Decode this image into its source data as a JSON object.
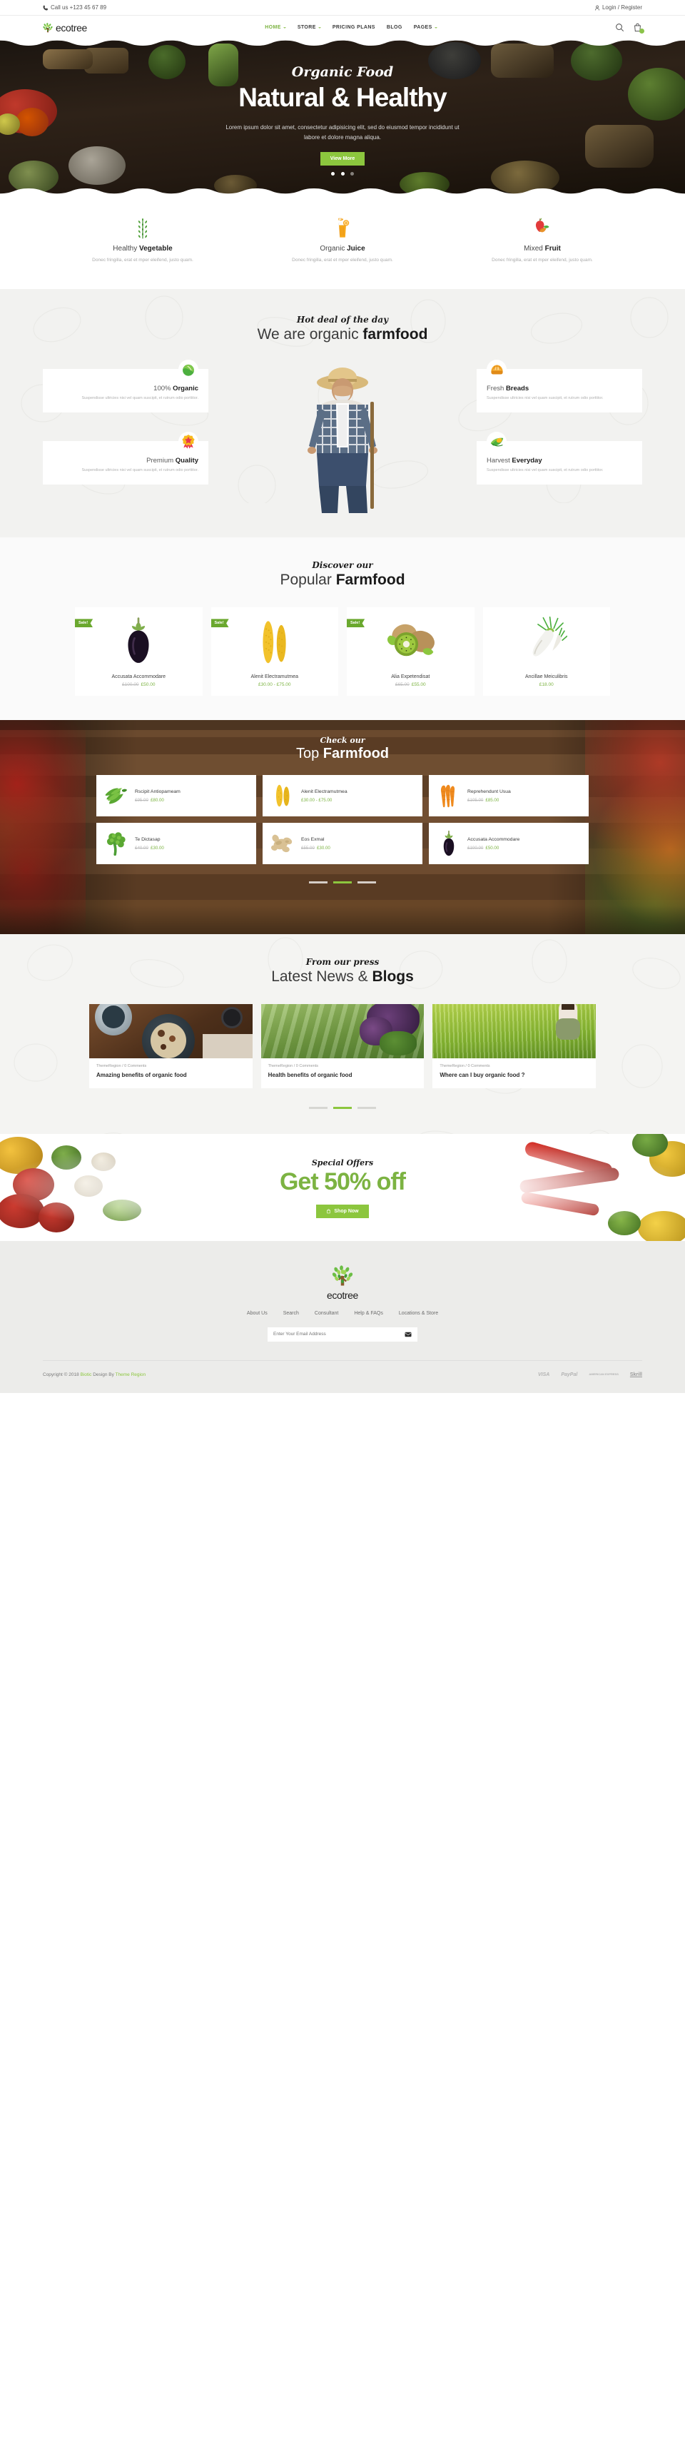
{
  "topbar": {
    "phone": "Call us +123 45 67 89",
    "account": "Login / Register"
  },
  "header": {
    "brand": "ecotree",
    "nav": [
      {
        "label": "HOME",
        "caret": true,
        "active": true
      },
      {
        "label": "STORE",
        "caret": true,
        "active": false
      },
      {
        "label": "PRICING PLANS",
        "caret": false,
        "active": false
      },
      {
        "label": "BLOG",
        "caret": false,
        "active": false
      },
      {
        "label": "PAGES",
        "caret": true,
        "active": false
      }
    ],
    "search_icon": "search-icon",
    "cart_icon": "cart-icon",
    "cart_count": ""
  },
  "hero": {
    "script": "Organic Food",
    "title": "Natural & Healthy",
    "desc": "Lorem ipsum dolor sit amet, consectetur adipisicing elit, sed do eiusmod tempor incididunt ut labore et dolore magna aliqua.",
    "button": "View More",
    "slides": 3,
    "active_slide": 1
  },
  "features": [
    {
      "icon": "wheat-icon",
      "title_light": "Healthy ",
      "title_bold": "Vegetable",
      "desc": "Donec fringilla, erat et mper eleifend, justo quam."
    },
    {
      "icon": "juice-icon",
      "title_light": "Organic ",
      "title_bold": "Juice",
      "desc": "Donec fringilla, erat et mper eleifend, justo quam."
    },
    {
      "icon": "fruit-icon",
      "title_light": "Mixed ",
      "title_bold": "Fruit",
      "desc": "Donec fringilla, erat et mper eleifend, justo quam."
    }
  ],
  "hotdeal": {
    "script": "Hot deal of the day",
    "title_light": "We are organic ",
    "title_bold": "farmfood",
    "left": [
      {
        "icon": "cabbage-icon",
        "title_light": "100% ",
        "title_bold": "Organic",
        "desc": "Suspendisse ultricies nisi vel quam suscipit, et rutrum odio porttitor."
      },
      {
        "icon": "medal-icon",
        "title_light": "Premium ",
        "title_bold": "Quality",
        "desc": "Suspendisse ultricies nisi vel quam suscipit, et rutrum odio porttitor."
      }
    ],
    "right": [
      {
        "icon": "bread-icon",
        "title_light": "Fresh ",
        "title_bold": "Breads",
        "desc": "Suspendisse ultricies nisi vel quam suscipit, et rutrum odio porttitor."
      },
      {
        "icon": "harvest-icon",
        "title_light": "Harvest ",
        "title_bold": "Everyday",
        "desc": "Suspendisse ultricies nisi vel quam suscipit, et rutrum odio porttitor."
      }
    ]
  },
  "popular": {
    "script": "Discover our",
    "title_light": "Popular ",
    "title_bold": "Farmfood",
    "products": [
      {
        "sale": "Sale!",
        "name": "Accusata Accommodare",
        "old": "£100.00",
        "price": "£50.00",
        "img": "eggplant-image"
      },
      {
        "sale": "Sale!",
        "name": "Alenit Electramutmea",
        "old": "",
        "price": "£30.00 - £75.00",
        "img": "corn-image"
      },
      {
        "sale": "Sale!",
        "name": "Alia Expetendisat",
        "old": "£65.00",
        "price": "£55.00",
        "img": "kiwi-image"
      },
      {
        "sale": "",
        "name": "Ancillae Meiculibris",
        "old": "",
        "price": "£18.00",
        "img": "radish-image"
      }
    ]
  },
  "topfarm": {
    "script": "Check our",
    "title_light": "Top ",
    "title_bold": "Farmfood",
    "items": [
      {
        "name": "Rscipit Antiopameam",
        "old": "£95.00",
        "price": "£80.00",
        "img": "beans-image"
      },
      {
        "name": "Alenit Electramutmea",
        "old": "",
        "price": "£30.00 - £75.00",
        "img": "corn-image"
      },
      {
        "name": "Reprehendunt Usua",
        "old": "£105.00",
        "price": "£85.00",
        "img": "carrot-image"
      },
      {
        "name": "Te Dictasap",
        "old": "£40.00",
        "price": "£30.00",
        "img": "broccoli-image"
      },
      {
        "name": "Eos Exmal",
        "old": "£55.00",
        "price": "£30.00",
        "img": "ginger-image"
      },
      {
        "name": "Accusata Accommodare",
        "old": "£100.00",
        "price": "£50.00",
        "img": "eggplant-image"
      }
    ],
    "pager": 3,
    "pager_active": 1
  },
  "blog": {
    "script": "From our press",
    "title_light": "Latest News & ",
    "title_bold": "Blogs",
    "posts": [
      {
        "meta": "ThemeRegion / 0 Comments",
        "title": "Amazing benefits of organic food",
        "img": "breakfast-bowl-image"
      },
      {
        "meta": "ThemeRegion / 0 Comments",
        "title": "Health benefits of organic food",
        "img": "vineyard-image"
      },
      {
        "meta": "ThemeRegion / 0 Comments",
        "title": "Where can I buy organic food ?",
        "img": "rice-field-image"
      }
    ],
    "pager": 3,
    "pager_active": 1
  },
  "offer": {
    "script": "Special Offers",
    "headline": "Get 50% off",
    "button": "Shop Now",
    "button_icon": "cart-icon"
  },
  "footer": {
    "brand": "ecotree",
    "links": [
      "About Us",
      "Search",
      "Consultant",
      "Help & FAQs",
      "Locations & Store"
    ],
    "newsletter_placeholder": "Enter Your Email Address",
    "newsletter_icon": "envelope-icon",
    "copyright_pre": "Copyright © 2018 ",
    "copyright_brand": "Biotic",
    "copyright_mid": " Design By ",
    "copyright_author": "Theme Region",
    "payments": [
      "VISA",
      "PayPal",
      "AMERICAN EXPRESS",
      "Skrill"
    ]
  },
  "colors": {
    "green": "#8cc63e",
    "dark_green": "#7cb342",
    "dark": "#1c1c1c"
  }
}
